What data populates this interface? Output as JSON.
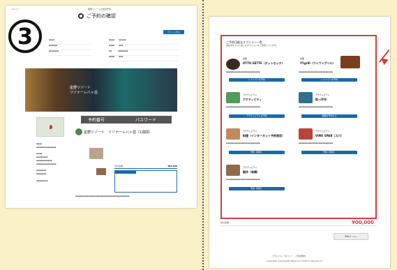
{
  "left": {
    "menu_label": "メニュー",
    "brand": "星野リゾートの宿泊予約",
    "title": "ご予約の確認",
    "step_number": "3",
    "top_button": "プリントする",
    "hotel_name": "星野リゾート　リゾナーレ八ヶ岳（1週間）",
    "reservation_label": "予約番号",
    "password_label": "パスワード",
    "total_label": "合計金額",
    "total_value": "¥00,000",
    "photo_caption_1": "星野リゾート",
    "photo_caption_2": "リゾナーレ八ヶ岳"
  },
  "right": {
    "section_title": "ご予約可能なオプション一覧",
    "section_subtitle": "滞在中をさらに楽しむオプションをご用意しています。",
    "options": [
      {
        "title": "OTTO SETTE（オットセッテ）",
        "category": "食事",
        "button": "レストランを予約",
        "color": "#3b2a1e"
      },
      {
        "title": "YYgrill（ワイワイグリル）",
        "category": "食事",
        "button": "レストランを予約",
        "color": "#7a3e1c"
      },
      {
        "title": "アクティビティ",
        "category": "アクティビティ",
        "button": "アクティビティを予約",
        "color": "#4f9b5c"
      },
      {
        "title": "取っ手作",
        "category": "アクティビティ",
        "button": "体験を予約する",
        "color": "#2f6f8f"
      },
      {
        "title": "料理（インターネット予約限定）",
        "category": "アクティビティ",
        "button": "予約（有料）",
        "color": "#c28a5a"
      },
      {
        "title": "VINO SPAЯ（スパ）",
        "category": "アクティビティ",
        "button": "予約（有料）",
        "color": "#b8443a"
      },
      {
        "title": "製作（有償）",
        "category": "アクティビティ",
        "button": "予約（有料）",
        "color": "#8e6b4a"
      }
    ],
    "total_label": "合計金額",
    "total_value": "¥00,000",
    "footer_button": "予約ページへ",
    "footer_links": "プライバシーポリシー　ご利用規約",
    "copyright": "Copyright (c)All Rights Reserved. Hoshino Resorts Inc."
  }
}
